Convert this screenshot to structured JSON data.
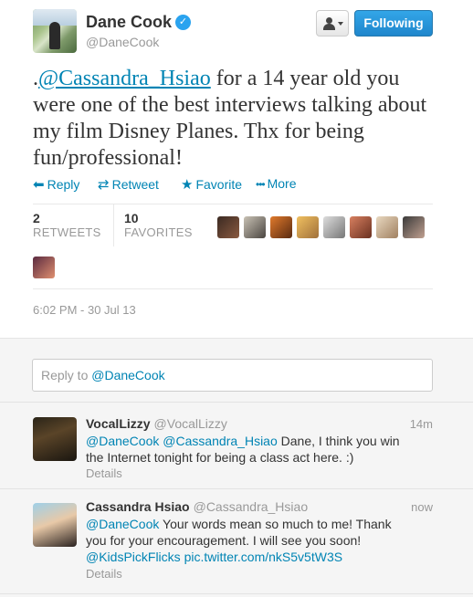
{
  "tweet": {
    "author_name": "Dane Cook",
    "author_handle": "@DaneCook",
    "verified_glyph": "✓",
    "following_label": "Following",
    "text_prefix": ".",
    "mention": "@Cassandra_Hsiao",
    "text_body": " for a 14 year old you were one of the best interviews talking about my film Disney Planes. Thx for being fun/professional!",
    "actions": [
      {
        "label": "Reply",
        "icon": "reply-icon",
        "glyph": "⬅"
      },
      {
        "label": "Retweet",
        "icon": "retweet-icon",
        "glyph": "⇄"
      },
      {
        "label": "Favorite",
        "icon": "star-icon",
        "glyph": "★"
      },
      {
        "label": "More",
        "icon": "more-icon",
        "glyph": "•••"
      }
    ],
    "retweets_count": "2",
    "retweets_label": "RETWEETS",
    "favorites_count": "10",
    "favorites_label": "FAVORITES",
    "timestamp": "6:02 PM - 30 Jul 13"
  },
  "reply_box": {
    "prefix": "Reply to ",
    "handle": "@DaneCook"
  },
  "replies": [
    {
      "name": "VocalLizzy",
      "handle": "@VocalLizzy",
      "time": "14m",
      "mentions": "@DaneCook @Cassandra_Hsiao",
      "text": " Dane, I think you win the Internet tonight for being a class act here. :)",
      "details": "Details"
    },
    {
      "name": "Cassandra Hsiao",
      "handle": "@Cassandra_Hsiao",
      "time": "now",
      "mentions": "@DaneCook",
      "text": " Your words mean so much to me! Thank you for your encouragement. I will see you soon!",
      "link1": "@KidsPickFlicks",
      "link2": "pic.twitter.com/nkS5v5tW3S",
      "details": "Details"
    }
  ],
  "colors": {
    "link": "#0084b4",
    "following_button": "#2aa3ef",
    "muted": "#999999"
  }
}
